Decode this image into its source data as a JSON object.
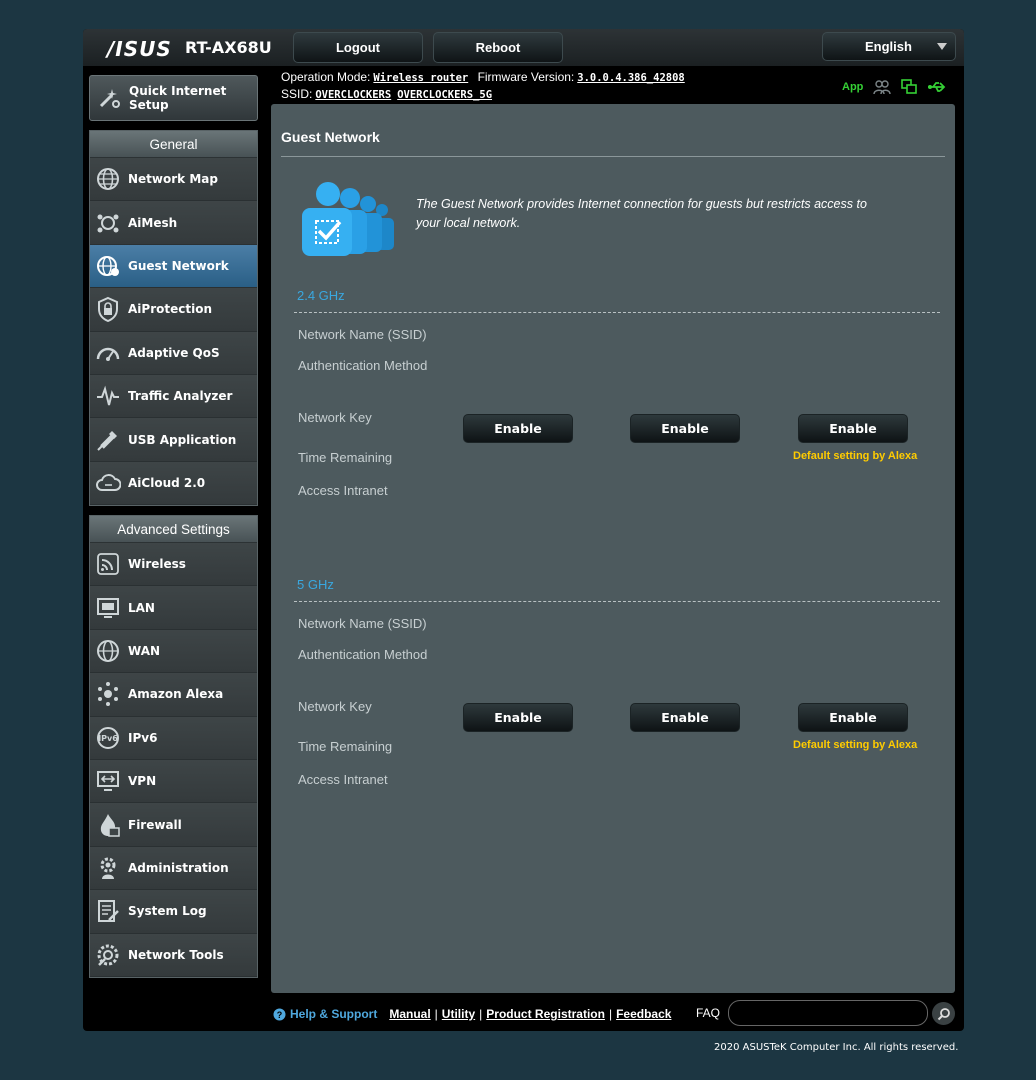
{
  "header": {
    "brand": "/ISUS",
    "model": "RT-AX68U",
    "logout_label": "Logout",
    "reboot_label": "Reboot",
    "language": "English"
  },
  "status": {
    "operation_mode_label": "Operation Mode:",
    "operation_mode_value": "Wireless router",
    "firmware_label": "Firmware Version:",
    "firmware_value": "3.0.0.4.386_42808",
    "ssid_label": "SSID:",
    "ssid_24": "OVERCLOCKERS",
    "ssid_5": "OVERCLOCKERS_5G",
    "app_label": "App"
  },
  "sidebar": {
    "quick_setup": "Quick Internet Setup",
    "general_header": "General",
    "general_items": [
      {
        "label": "Network Map",
        "icon": "globe-icon"
      },
      {
        "label": "AiMesh",
        "icon": "mesh-icon"
      },
      {
        "label": "Guest Network",
        "icon": "guest-globe-icon",
        "active": true
      },
      {
        "label": "AiProtection",
        "icon": "shield-lock-icon"
      },
      {
        "label": "Adaptive QoS",
        "icon": "gauge-icon"
      },
      {
        "label": "Traffic Analyzer",
        "icon": "pulse-icon"
      },
      {
        "label": "USB Application",
        "icon": "usb-icon"
      },
      {
        "label": "AiCloud 2.0",
        "icon": "cloud-icon"
      }
    ],
    "advanced_header": "Advanced Settings",
    "advanced_items": [
      {
        "label": "Wireless",
        "icon": "wifi-icon"
      },
      {
        "label": "LAN",
        "icon": "lan-icon"
      },
      {
        "label": "WAN",
        "icon": "wan-globe-icon"
      },
      {
        "label": "Amazon Alexa",
        "icon": "alexa-icon"
      },
      {
        "label": "IPv6",
        "icon": "ipv6-icon"
      },
      {
        "label": "VPN",
        "icon": "vpn-icon"
      },
      {
        "label": "Firewall",
        "icon": "firewall-icon"
      },
      {
        "label": "Administration",
        "icon": "admin-gear-icon"
      },
      {
        "label": "System Log",
        "icon": "log-icon"
      },
      {
        "label": "Network Tools",
        "icon": "tools-icon"
      }
    ]
  },
  "main": {
    "title": "Guest Network",
    "description": "The Guest Network provides Internet connection for guests but restricts access to your local network.",
    "bands": [
      {
        "name": "2.4 GHz",
        "rows": [
          "Network Name (SSID)",
          "Authentication Method",
          "Network Key",
          "Time Remaining",
          "Access Intranet"
        ],
        "enable_labels": [
          "Enable",
          "Enable",
          "Enable"
        ],
        "alexa_note": "Default setting by Alexa"
      },
      {
        "name": "5 GHz",
        "rows": [
          "Network Name (SSID)",
          "Authentication Method",
          "Network Key",
          "Time Remaining",
          "Access Intranet"
        ],
        "enable_labels": [
          "Enable",
          "Enable",
          "Enable"
        ],
        "alexa_note": "Default setting by Alexa"
      }
    ]
  },
  "footer": {
    "help": "Help & Support",
    "links": [
      "Manual",
      "Utility",
      "Product Registration",
      "Feedback"
    ],
    "faq_label": "FAQ",
    "copyright": "2020 ASUSTeK Computer Inc. All rights reserved."
  },
  "colors": {
    "background": "#1c3642",
    "panel": "#4d5a5e",
    "accent_blue": "#39a8e0",
    "alexa_yellow": "#ffcc00",
    "active_menu": "#2a5f86",
    "app_green": "#35d035"
  }
}
